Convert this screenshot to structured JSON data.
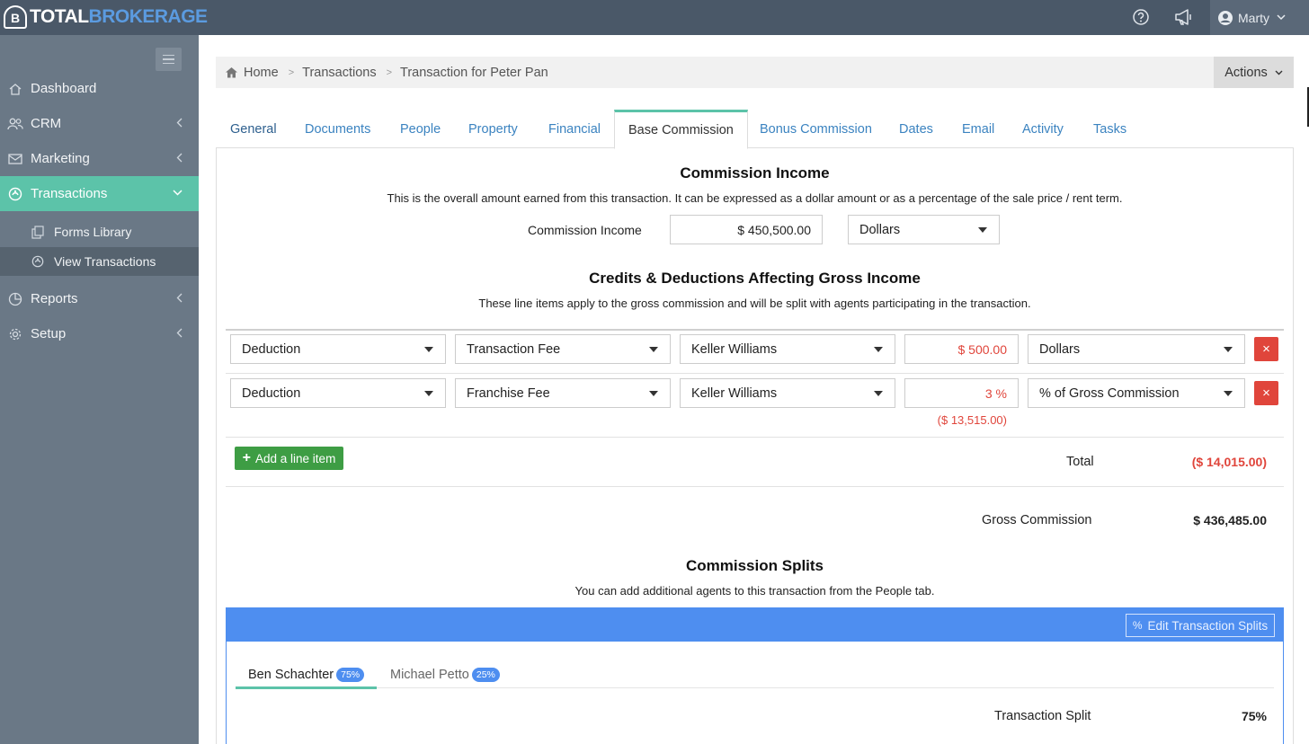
{
  "brand": {
    "part1": "TOTAL",
    "part2": "BROKERAGE",
    "mark": "B"
  },
  "user": {
    "name": "Marty"
  },
  "sidebar": {
    "items": [
      {
        "label": "Dashboard"
      },
      {
        "label": "CRM"
      },
      {
        "label": "Marketing"
      },
      {
        "label": "Transactions"
      },
      {
        "label": "Reports"
      },
      {
        "label": "Setup"
      }
    ],
    "subitems": [
      {
        "label": "Forms Library"
      },
      {
        "label": "View Transactions"
      }
    ]
  },
  "breadcrumb": {
    "home": "Home",
    "transactions": "Transactions",
    "current": "Transaction for Peter Pan"
  },
  "actions_label": "Actions",
  "tabs": [
    "General",
    "Documents",
    "People",
    "Property",
    "Financial",
    "Base Commission",
    "Bonus Commission",
    "Dates",
    "Email",
    "Activity",
    "Tasks"
  ],
  "commission_income": {
    "heading": "Commission Income",
    "description": "This is the overall amount earned from this transaction. It can be expressed as a dollar amount or as a percentage of the sale price / rent term.",
    "label": "Commission Income",
    "value": "$ 450,500.00",
    "unit": "Dollars"
  },
  "credits": {
    "heading": "Credits & Deductions Affecting Gross Income",
    "description": "These line items apply to the gross commission and will be split with agents participating in the transaction.",
    "rows": [
      {
        "type": "Deduction",
        "name": "Transaction Fee",
        "payee": "Keller Williams",
        "amount": "$ 500.00",
        "unit": "Dollars",
        "computed": ""
      },
      {
        "type": "Deduction",
        "name": "Franchise Fee",
        "payee": "Keller Williams",
        "amount": "3 %",
        "unit": "% of Gross Commission",
        "computed": "($ 13,515.00)"
      }
    ],
    "add_label": "Add a line item",
    "total_label": "Total",
    "total_value": "($ 14,015.00)",
    "remove_symbol": "×"
  },
  "gross": {
    "label": "Gross Commission",
    "value": "$ 436,485.00"
  },
  "splits": {
    "heading": "Commission Splits",
    "description": "You can add additional agents to this transaction from the People tab.",
    "edit_label": "Edit Transaction Splits",
    "agents": [
      {
        "name": "Ben Schachter",
        "pct": "75%"
      },
      {
        "name": "Michael Petto",
        "pct": "25%"
      }
    ],
    "split_label": "Transaction Split",
    "split_value": "75%"
  }
}
